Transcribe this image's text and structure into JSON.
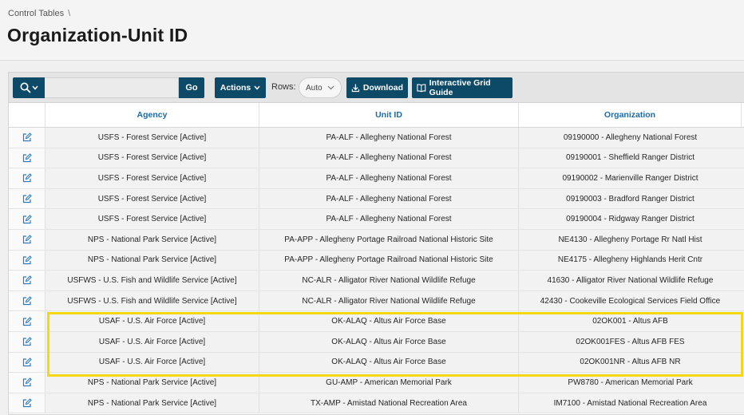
{
  "breadcrumb": {
    "item": "Control Tables",
    "separator": "\\"
  },
  "page_title": "Organization-Unit ID",
  "toolbar": {
    "go_label": "Go",
    "actions_label": "Actions",
    "rows_label": "Rows:",
    "rows_value": "Auto",
    "download_label": "Download",
    "guide_label": "Interactive Grid Guide",
    "search_placeholder": ""
  },
  "columns": [
    "Agency",
    "Unit ID",
    "Organization"
  ],
  "rows": [
    [
      "USFS - Forest Service [Active]",
      "PA-ALF - Allegheny National Forest",
      "09190000 - Allegheny National Forest"
    ],
    [
      "USFS - Forest Service [Active]",
      "PA-ALF - Allegheny National Forest",
      "09190001 - Sheffield Ranger District"
    ],
    [
      "USFS - Forest Service [Active]",
      "PA-ALF - Allegheny National Forest",
      "09190002 - Marienville Ranger District"
    ],
    [
      "USFS - Forest Service [Active]",
      "PA-ALF - Allegheny National Forest",
      "09190003 - Bradford Ranger District"
    ],
    [
      "USFS - Forest Service [Active]",
      "PA-ALF - Allegheny National Forest",
      "09190004 - Ridgway Ranger District"
    ],
    [
      "NPS - National Park Service [Active]",
      "PA-APP - Allegheny Portage Railroad National Historic Site",
      "NE4130 - Allegheny Portage Rr Natl Hist"
    ],
    [
      "NPS - National Park Service [Active]",
      "PA-APP - Allegheny Portage Railroad National Historic Site",
      "NE4175 - Allegheny Highlands Herit Cntr"
    ],
    [
      "USFWS - U.S. Fish and Wildlife Service [Active]",
      "NC-ALR - Alligator River National Wildlife Refuge",
      "41630 - Alligator River National Wildlife Refuge"
    ],
    [
      "USFWS - U.S. Fish and Wildlife Service [Active]",
      "NC-ALR - Alligator River National Wildlife Refuge",
      "42430 - Cookeville Ecological Services Field Office"
    ],
    [
      "USAF - U.S. Air Force [Active]",
      "OK-ALAQ - Altus Air Force Base",
      "02OK001 - Altus AFB"
    ],
    [
      "USAF - U.S. Air Force [Active]",
      "OK-ALAQ - Altus Air Force Base",
      "02OK001FES - Altus AFB FES"
    ],
    [
      "USAF - U.S. Air Force [Active]",
      "OK-ALAQ - Altus Air Force Base",
      "02OK001NR - Altus AFB NR"
    ],
    [
      "NPS - National Park Service [Active]",
      "GU-AMP - American Memorial Park",
      "PW8780 - American Memorial Park"
    ],
    [
      "NPS - National Park Service [Active]",
      "TX-AMP - Amistad National Recreation Area",
      "IM7100 - Amistad National Recreation Area"
    ]
  ],
  "colors": {
    "button": "#0d4a68",
    "header_link": "#1d6aa8",
    "highlight": "#f6d810",
    "edit_icon": "#2e7bbf"
  },
  "icons": {
    "search": "search-icon",
    "edit": "edit-icon",
    "download": "download-icon",
    "guide": "book-icon",
    "chevron": "chevron-down-icon"
  }
}
